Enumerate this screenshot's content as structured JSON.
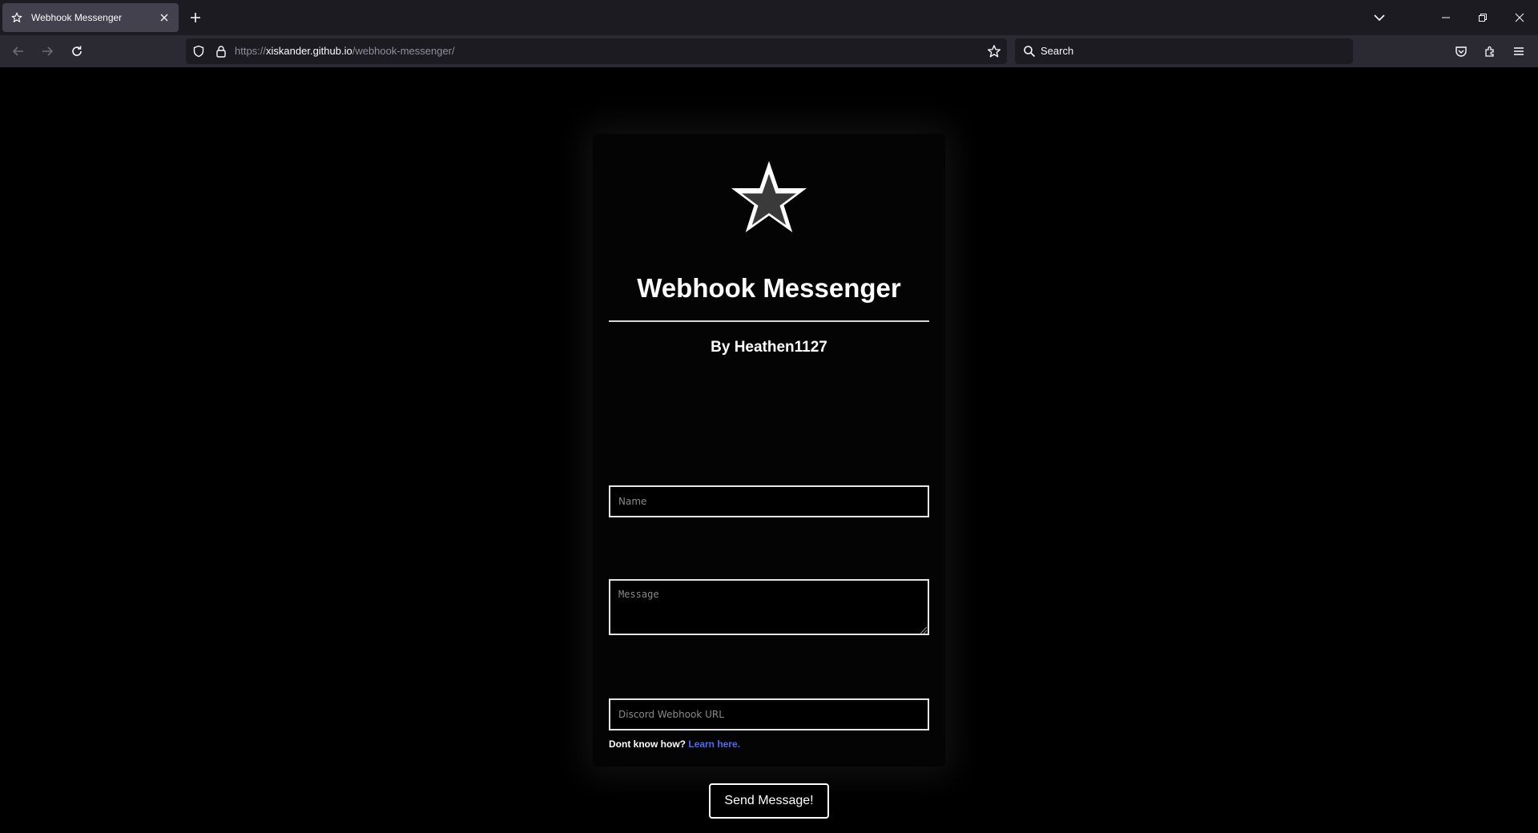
{
  "browser": {
    "tab": {
      "title": "Webhook Messenger",
      "icon": "star-icon"
    },
    "address": {
      "scheme": "https://",
      "host": "xiskander.github.io",
      "path": "/webhook-messenger/"
    },
    "search": {
      "placeholder": "Search"
    }
  },
  "page": {
    "logo": "star-icon",
    "title": "Webhook Messenger",
    "subtitle": "By Heathen1127",
    "form": {
      "name_placeholder": "Name",
      "message_placeholder": "Message",
      "webhook_placeholder": "Discord Webhook URL",
      "help_text": "Dont know how? ",
      "help_link": "Learn here.",
      "submit_label": "Send Message!"
    }
  },
  "colors": {
    "background": "#000000",
    "chrome_tabbar": "#1c1b22",
    "chrome_navbar": "#2b2a33",
    "link": "#4a6cf7"
  }
}
